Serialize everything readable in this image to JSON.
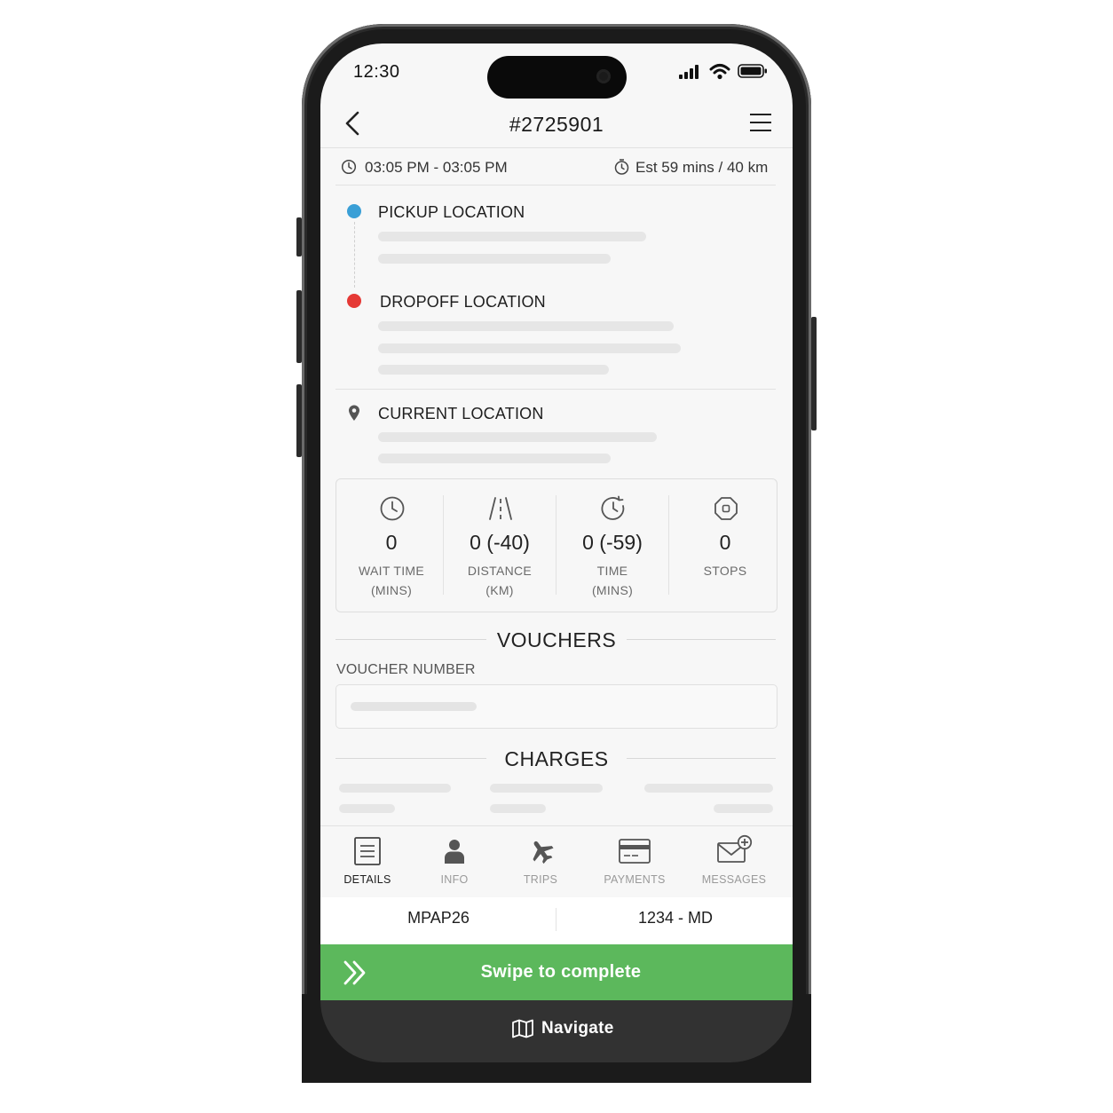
{
  "status_bar": {
    "time": "12:30",
    "icons": [
      "signal-icon",
      "wifi-icon",
      "battery-icon"
    ]
  },
  "header": {
    "title": "#2725901",
    "back_icon": "chevron-left-icon",
    "menu_icon": "hamburger-menu-icon"
  },
  "trip_meta": {
    "time_range": "03:05 PM - 03:05 PM",
    "estimate": "Est 59 mins / 40 km"
  },
  "locations": {
    "pickup": {
      "label": "PICKUP LOCATION",
      "color": "#3a9fd6"
    },
    "dropoff": {
      "label": "DROPOFF LOCATION",
      "color": "#e53935"
    },
    "current": {
      "label": "CURRENT LOCATION"
    }
  },
  "stats": [
    {
      "icon": "clock-icon",
      "value": "0",
      "label_1": "WAIT TIME",
      "label_2": "(MINS)"
    },
    {
      "icon": "road-icon",
      "value": "0 (-40)",
      "label_1": "DISTANCE",
      "label_2": "(KM)"
    },
    {
      "icon": "history-clock-icon",
      "value": "0 (-59)",
      "label_1": "TIME",
      "label_2": "(MINS)"
    },
    {
      "icon": "stop-octagon-icon",
      "value": "0",
      "label_1": "STOPS",
      "label_2": ""
    }
  ],
  "vouchers": {
    "title": "VOUCHERS",
    "field_label": "VOUCHER NUMBER"
  },
  "charges": {
    "title": "CHARGES"
  },
  "bottom_nav": [
    {
      "icon": "document-icon",
      "label": "DETAILS",
      "active": true
    },
    {
      "icon": "person-icon",
      "label": "INFO",
      "active": false
    },
    {
      "icon": "airplane-icon",
      "label": "TRIPS",
      "active": false
    },
    {
      "icon": "credit-card-icon",
      "label": "PAYMENTS",
      "active": false
    },
    {
      "icon": "envelope-plus-icon",
      "label": "MESSAGES",
      "active": false
    }
  ],
  "vehicle": {
    "code": "MPAP26",
    "plate": "1234 - MD"
  },
  "actions": {
    "swipe_label": "Swipe to complete",
    "navigate_label": "Navigate"
  },
  "colors": {
    "swipe_green": "#5cb85c",
    "navigate_dark": "#323232"
  }
}
